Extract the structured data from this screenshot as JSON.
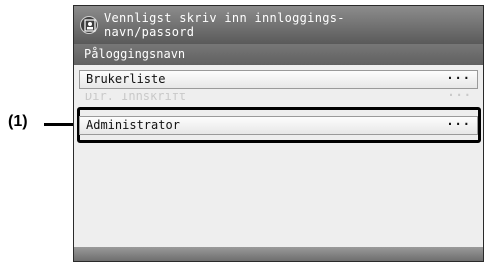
{
  "callout": {
    "label": "(1)"
  },
  "header": {
    "icon": "user-login-icon",
    "message": "Vennligst skriv inn innloggings-\nnavn/passord"
  },
  "subheader": {
    "title": "Påloggingsnavn"
  },
  "list": {
    "items": [
      {
        "label": "Brukerliste",
        "more": "···"
      },
      {
        "label": "Dir. Innskrift",
        "more": "···"
      },
      {
        "label": "Administrator",
        "more": "···"
      }
    ]
  }
}
